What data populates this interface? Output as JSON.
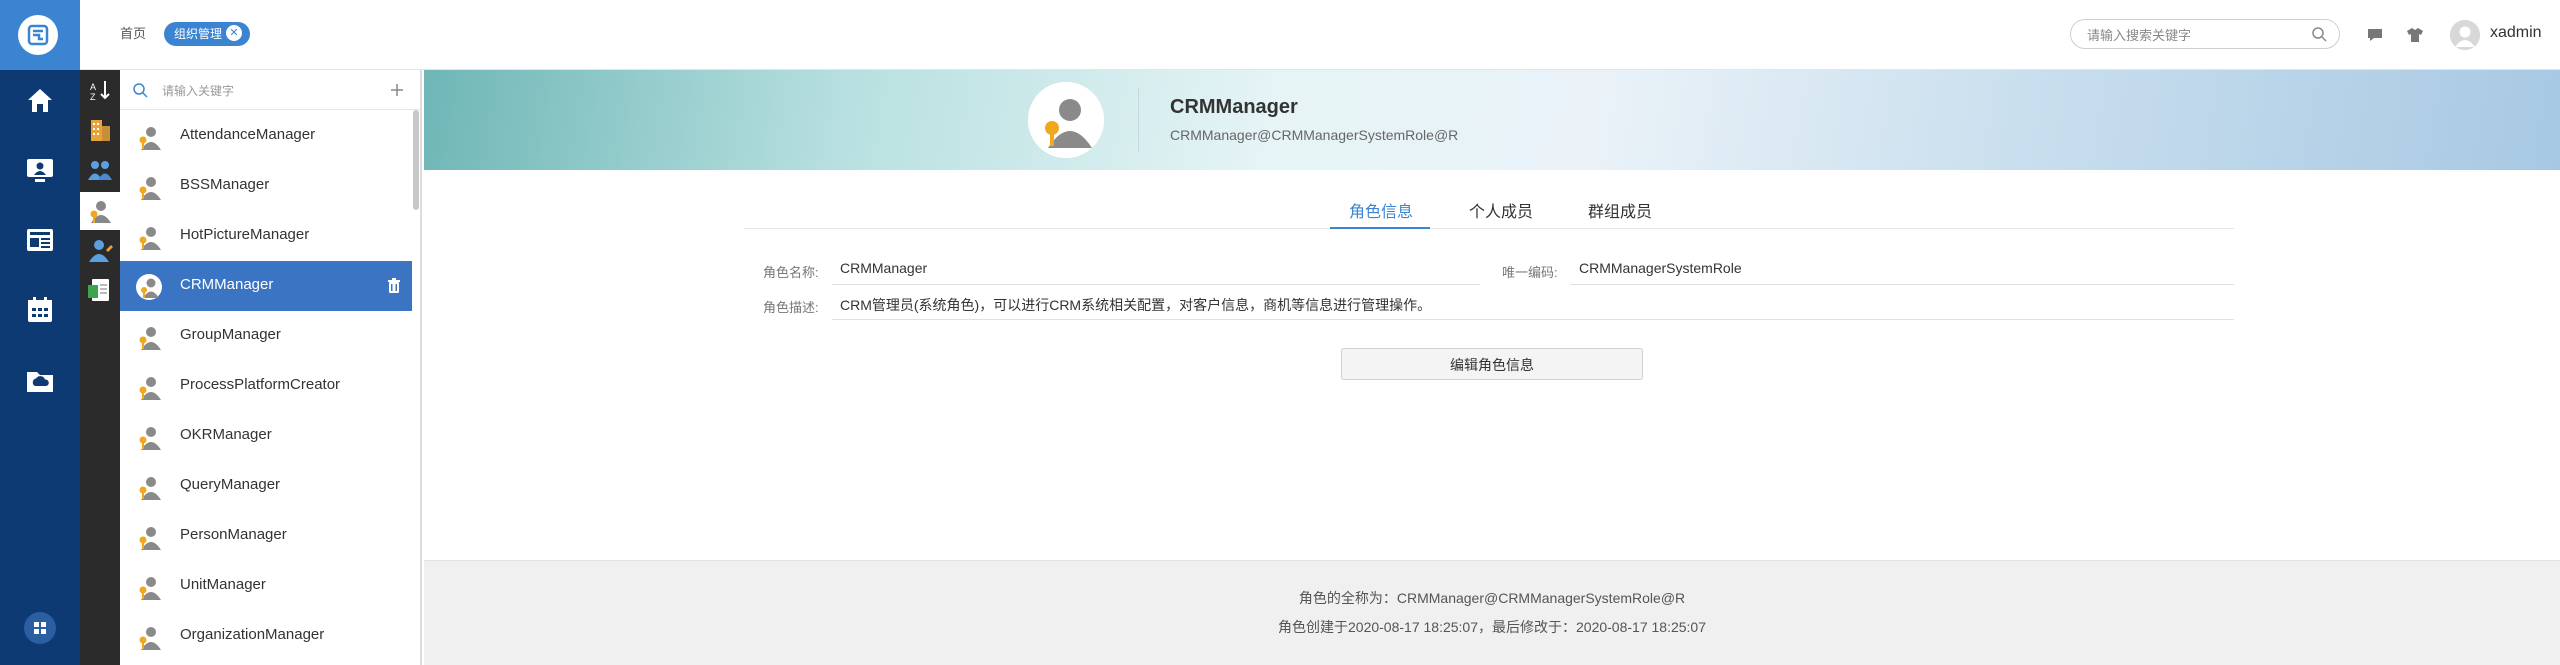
{
  "app": {
    "tabs": [
      {
        "label": "首页"
      },
      {
        "label": "组织管理"
      }
    ],
    "search_placeholder": "请输入搜索关键字",
    "username": "xadmin"
  },
  "left_nav": {
    "icons": [
      "home-icon",
      "monitor-person-icon",
      "newspaper-icon",
      "calendar-icon",
      "cloud-folder-icon"
    ],
    "bottom": "grid-apps-icon"
  },
  "tool_strip": [
    "sort-icon",
    "building-icon",
    "group-icon",
    "role-icon",
    "person-edit-icon",
    "document-icon"
  ],
  "list": {
    "search_placeholder": "请输入关键字",
    "items": [
      {
        "label": "AttendanceManager"
      },
      {
        "label": "BSSManager"
      },
      {
        "label": "HotPictureManager"
      },
      {
        "label": "CRMManager",
        "selected": true
      },
      {
        "label": "GroupManager"
      },
      {
        "label": "ProcessPlatformCreator"
      },
      {
        "label": "OKRManager"
      },
      {
        "label": "QueryManager"
      },
      {
        "label": "PersonManager"
      },
      {
        "label": "UnitManager"
      },
      {
        "label": "OrganizationManager"
      }
    ]
  },
  "detail": {
    "title": "CRMManager",
    "subtitle": "CRMManager@CRMManagerSystemRole@R",
    "tabs": [
      {
        "label": "角色信息",
        "active": true
      },
      {
        "label": "个人成员"
      },
      {
        "label": "群组成员"
      }
    ],
    "fields": {
      "name_label": "角色名称:",
      "name_value": "CRMManager",
      "code_label": "唯一编码:",
      "code_value": "CRMManagerSystemRole",
      "desc_label": "角色描述:",
      "desc_value": "CRM管理员(系统角色)，可以进行CRM系统相关配置，对客户信息，商机等信息进行管理操作。"
    },
    "edit_button": "编辑角色信息",
    "footer": {
      "full_name": "角色的全称为：CRMManager@CRMManagerSystemRole@R",
      "timestamps": "角色创建于2020-08-17 18:25:07，最后修改于：2020-08-17 18:25:07"
    }
  },
  "colors": {
    "nav_bg": "#0e3a73",
    "accent": "#3b84d1",
    "selected_row": "#3b74c2",
    "toolstrip_bg": "#2b2b2b"
  }
}
